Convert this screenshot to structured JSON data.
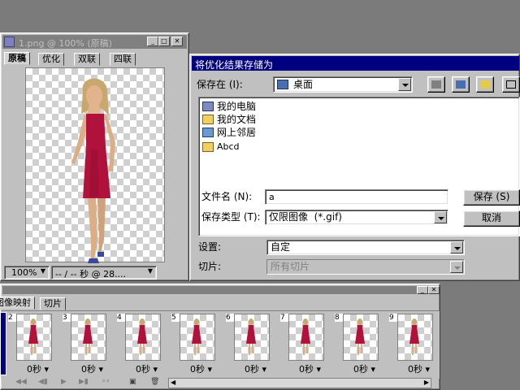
{
  "doc_window": {
    "title": "1.png @ 100% (原稿)",
    "tabs": [
      "原稿",
      "优化",
      "双联",
      "四联"
    ],
    "zoom": "100%",
    "status": "-- / -- 秒 @ 28...."
  },
  "dialog": {
    "title": "将优化结果存储为",
    "save_in_label": "保存在 (I):",
    "save_in_value": "桌面",
    "files": [
      {
        "name": "我的电脑",
        "icon": "computer-icon"
      },
      {
        "name": "我的文档",
        "icon": "documents-folder-icon"
      },
      {
        "name": "网上邻居",
        "icon": "network-icon"
      },
      {
        "name": "Abcd",
        "icon": "folder-icon"
      }
    ],
    "filename_label": "文件名 (N):",
    "filename_value": "a",
    "filetype_label": "保存类型 (T):",
    "filetype_value": "仅限图像  (*.gif)",
    "settings_label": "设置:",
    "settings_value": "自定",
    "slice_label": "切片:",
    "slice_value": "所有切片",
    "save_button": "保存 (S)",
    "cancel_button": "取消"
  },
  "animation_panel": {
    "tabs": [
      "图像映射",
      "切片"
    ],
    "frames": [
      {
        "num": "2",
        "delay": "0秒"
      },
      {
        "num": "3",
        "delay": "0秒"
      },
      {
        "num": "4",
        "delay": "0秒"
      },
      {
        "num": "5",
        "delay": "0秒"
      },
      {
        "num": "6",
        "delay": "0秒"
      },
      {
        "num": "7",
        "delay": "0秒"
      },
      {
        "num": "8",
        "delay": "0秒"
      },
      {
        "num": "9",
        "delay": "0秒"
      }
    ]
  },
  "colors": {
    "active_title": "#000080",
    "inactive_title": "#808080",
    "dress": "#b0123c",
    "desktop": "#7b7b7b"
  }
}
